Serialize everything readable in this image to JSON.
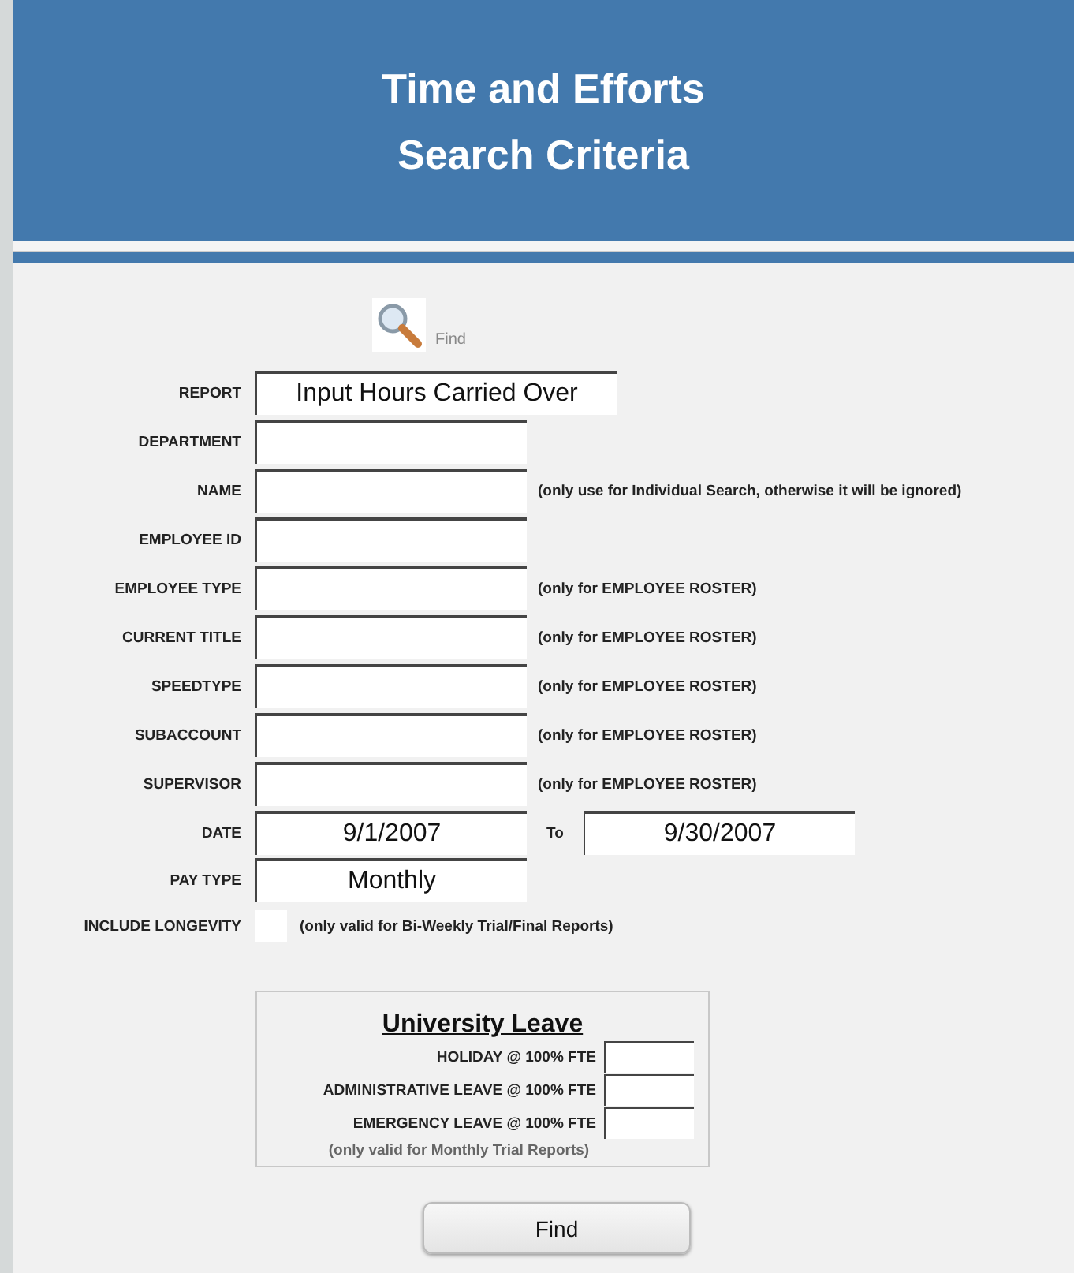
{
  "header": {
    "title_lines": [
      "Time and Efforts",
      "Search Criteria"
    ]
  },
  "find_tool": {
    "label": "Find"
  },
  "fields": [
    {
      "kind": "text",
      "label": "REPORT",
      "value": "Input Hours Carried Over",
      "wide": true
    },
    {
      "kind": "text",
      "label": "DEPARTMENT"
    },
    {
      "kind": "text",
      "label": "NAME",
      "note": "(only use for Individual Search, otherwise it will be ignored)"
    },
    {
      "kind": "text",
      "label": "EMPLOYEE ID"
    },
    {
      "kind": "text",
      "label": "EMPLOYEE TYPE",
      "note": "(only for EMPLOYEE ROSTER)"
    },
    {
      "kind": "text",
      "label": "CURRENT TITLE",
      "note": "(only for EMPLOYEE ROSTER)"
    },
    {
      "kind": "text",
      "label": "SPEEDTYPE",
      "note": "(only for EMPLOYEE ROSTER)"
    },
    {
      "kind": "text",
      "label": "SUBACCOUNT",
      "note": "(only for EMPLOYEE ROSTER)"
    },
    {
      "kind": "text",
      "label": "SUPERVISOR",
      "note": "(only for EMPLOYEE ROSTER)"
    },
    {
      "kind": "range",
      "label": "DATE",
      "value": "9/1/2007",
      "to_label": "To",
      "to_value": "9/30/2007"
    },
    {
      "kind": "text",
      "label": "PAY TYPE",
      "value": "Monthly"
    },
    {
      "kind": "checkbox",
      "label": "INCLUDE LONGEVITY",
      "checked": false,
      "note": "(only valid for Bi-Weekly Trial/Final Reports)"
    }
  ],
  "leave_panel": {
    "title": "University Leave",
    "rows": [
      {
        "label": "HOLIDAY @ 100% FTE"
      },
      {
        "label": "ADMINISTRATIVE LEAVE @ 100% FTE"
      },
      {
        "label": "EMERGENCY LEAVE @ 100% FTE"
      }
    ],
    "note": "(only valid for Monthly Trial Reports)"
  },
  "button": {
    "label": "Find"
  }
}
